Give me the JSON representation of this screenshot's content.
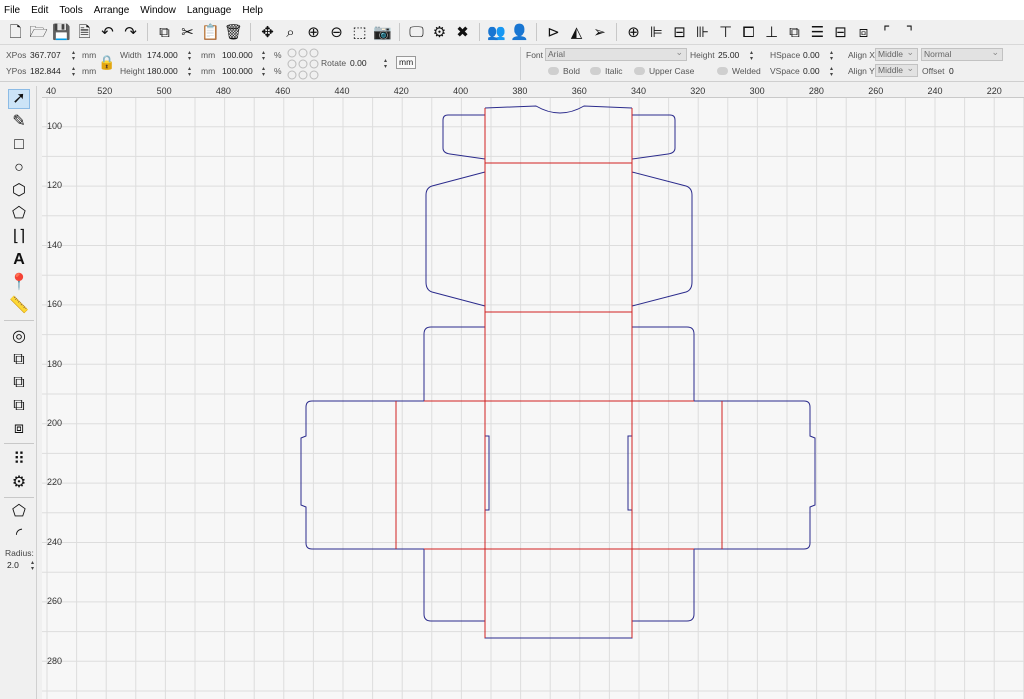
{
  "menu": [
    "File",
    "Edit",
    "Tools",
    "Arrange",
    "Window",
    "Language",
    "Help"
  ],
  "toolbar_icons": [
    "new-file",
    "open-file",
    "save-file",
    "export-file",
    "undo",
    "redo",
    "copy",
    "cut",
    "paste",
    "delete",
    "move",
    "zoom-fit",
    "zoom-in",
    "zoom-out",
    "select-rect",
    "camera",
    "monitor",
    "settings",
    "tools",
    "group-users",
    "user",
    "mirror-horizontal",
    "mirror-vertical",
    "send-to",
    "target",
    "align-left",
    "align-center",
    "align-right",
    "align-top",
    "align-middle",
    "align-bottom",
    "distribute-h",
    "distribute-v",
    "same-width",
    "same-height",
    "corner-tl",
    "corner-tr"
  ],
  "props": {
    "xpos_label": "XPos",
    "xpos": "367.707",
    "ypos_label": "YPos",
    "ypos": "182.844",
    "unit": "mm",
    "width_label": "Width",
    "width": "174.000",
    "height_label": "Height",
    "height": "180.000",
    "scale_w": "100.000",
    "scale_h": "100.000",
    "pct": "%",
    "rotate_label": "Rotate",
    "rotate": "0.00",
    "mm_button": "mm"
  },
  "text_props": {
    "font_label": "Font",
    "font": "Arial",
    "height_label": "Height",
    "height": "25.00",
    "hspace_label": "HSpace",
    "hspace": "0.00",
    "vspace_label": "VSpace",
    "vspace": "0.00",
    "alignx_label": "Align X",
    "alignx": "Middle",
    "aligny_label": "Align Y",
    "aligny": "Middle",
    "mode": "Normal",
    "offset_label": "Offset",
    "offset": "0",
    "bold": "Bold",
    "italic": "Italic",
    "upper": "Upper Case",
    "welded": "Welded"
  },
  "left_tools": [
    "select-arrow",
    "pencil",
    "rectangle",
    "ellipse",
    "polygon",
    "pentagon",
    "position",
    "text",
    "location-pin",
    "measure",
    "offset",
    "weld",
    "union",
    "subtract",
    "intersect",
    "array-grid",
    "array-circular",
    "corner-edit",
    "corner-round"
  ],
  "radius_label": "Radius:",
  "radius": "2.0",
  "hruler_labels": [
    "40",
    "520",
    "500",
    "480",
    "460",
    "440",
    "420",
    "400",
    "380",
    "360",
    "340",
    "320",
    "300",
    "280",
    "260",
    "240",
    "220"
  ],
  "vruler_labels": [
    "100",
    "120",
    "140",
    "160",
    "180",
    "200",
    "220",
    "240",
    "260",
    "280"
  ],
  "colors": {
    "cut": "#2b2b8c",
    "score": "#d02020",
    "grid": "#dddddd",
    "canvas_bg": "#f7f7f7"
  }
}
